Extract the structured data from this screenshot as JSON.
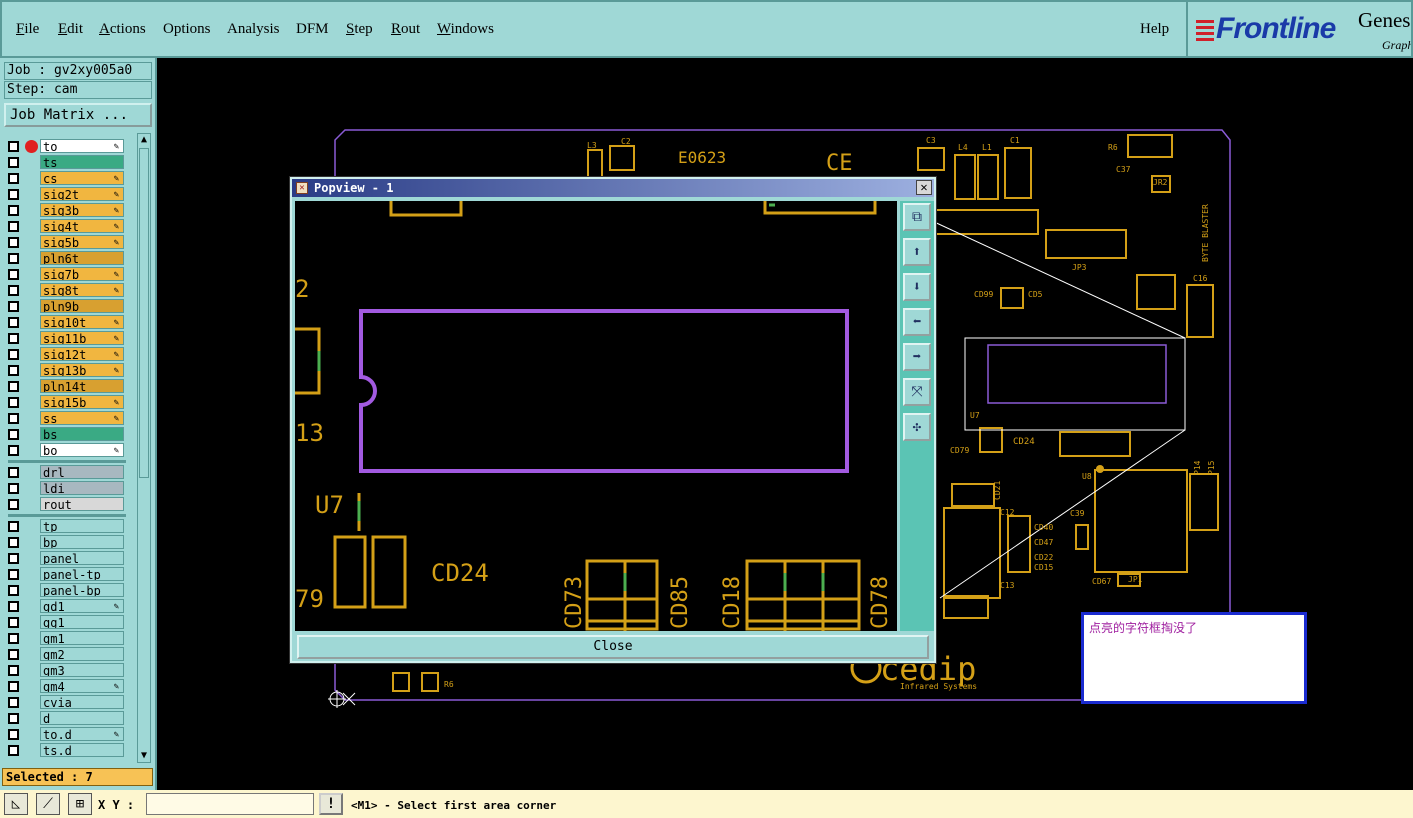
{
  "menu": {
    "file": "File",
    "edit": "Edit",
    "actions": "Actions",
    "options": "Options",
    "analysis": "Analysis",
    "dfm": "DFM",
    "step": "Step",
    "rout": "Rout",
    "windows": "Windows",
    "help": "Help"
  },
  "logo": {
    "brand": "Frontline",
    "product": "Genes",
    "subtitle": "Graphi"
  },
  "job": {
    "job_label": "Job : gv2xy005a0",
    "step_label": "Step: cam",
    "matrix_button": "Job Matrix ..."
  },
  "layers": [
    {
      "name": "to",
      "color": "#ffffff"
    },
    {
      "name": "ts",
      "color": "#3aaa84"
    },
    {
      "name": "cs",
      "color": "#f1b640"
    },
    {
      "name": "sig2t",
      "color": "#f1b640"
    },
    {
      "name": "sig3b",
      "color": "#f1b640"
    },
    {
      "name": "sig4t",
      "color": "#f1b640"
    },
    {
      "name": "sig5b",
      "color": "#f1b640"
    },
    {
      "name": "pln6t",
      "color": "#d8a030"
    },
    {
      "name": "sig7b",
      "color": "#f1b640"
    },
    {
      "name": "sig8t",
      "color": "#f1b640"
    },
    {
      "name": "pln9b",
      "color": "#d8a030"
    },
    {
      "name": "sig10t",
      "color": "#f1b640"
    },
    {
      "name": "sig11b",
      "color": "#f1b640"
    },
    {
      "name": "sig12t",
      "color": "#f1b640"
    },
    {
      "name": "sig13b",
      "color": "#f1b640"
    },
    {
      "name": "pln14t",
      "color": "#d8a030"
    },
    {
      "name": "sig15b",
      "color": "#f1b640"
    },
    {
      "name": "ss",
      "color": "#f1b640"
    },
    {
      "name": "bs",
      "color": "#3aaa84"
    },
    {
      "name": "bo",
      "color": "#ffffff"
    }
  ],
  "drill_layers": [
    {
      "name": "drl",
      "color": "#a8b8c0"
    },
    {
      "name": "ldi",
      "color": "#a8b8c0"
    },
    {
      "name": "rout",
      "color": "#d8d8d8"
    }
  ],
  "misc_layers": [
    "tp",
    "bp",
    "panel",
    "panel-tp",
    "panel-bp",
    "gd1",
    "gg1",
    "gm1",
    "gm2",
    "gm3",
    "gm4",
    "cvia",
    "d",
    "to.d",
    "ts.d"
  ],
  "selected": "Selected : 7",
  "statusbar": {
    "xy_label": "X Y :",
    "warn": "!",
    "prompt": "<M1> - Select first area corner"
  },
  "popview": {
    "title": "Popview - 1",
    "close": "Close"
  },
  "pcb_labels": {
    "e0623": "E0623",
    "ce": "CE",
    "l3": "L3",
    "c2": "C2",
    "c3": "C3",
    "l4": "L4",
    "l1": "L1",
    "c1": "C1",
    "r6": "R6",
    "c37": "C37",
    "jr2": "JR2",
    "byte": "BYTE BLASTER",
    "jp3": "JP3",
    "c16": "C16",
    "cd99": "CD99",
    "cd5": "CD5",
    "cd24": "CD24",
    "cd79": "CD79",
    "u7": "U7",
    "u8": "U8",
    "c39": "C39",
    "cd21": "CD21",
    "c12": "C12",
    "cd40": "CD40",
    "cd47": "CD47",
    "cd22": "CD22",
    "cd15": "CD15",
    "c13": "C13",
    "cd67": "CD67",
    "jp1": "JP1",
    "p14": "P14",
    "p15": "P15",
    "r6b": "R6",
    "cedip": "cedip",
    "infrared": "Infrared Systems",
    "pv_2": "2",
    "pv_13": "13",
    "pv_u7": "U7",
    "pv_cd24": "CD24",
    "pv_79": "79",
    "pv_cd73": "CD73",
    "pv_cd85": "CD85",
    "pv_cd18": "CD18",
    "pv_cd78": "CD78",
    "pv_cd22": "CD22"
  },
  "note": "点亮的字符框掏没了"
}
